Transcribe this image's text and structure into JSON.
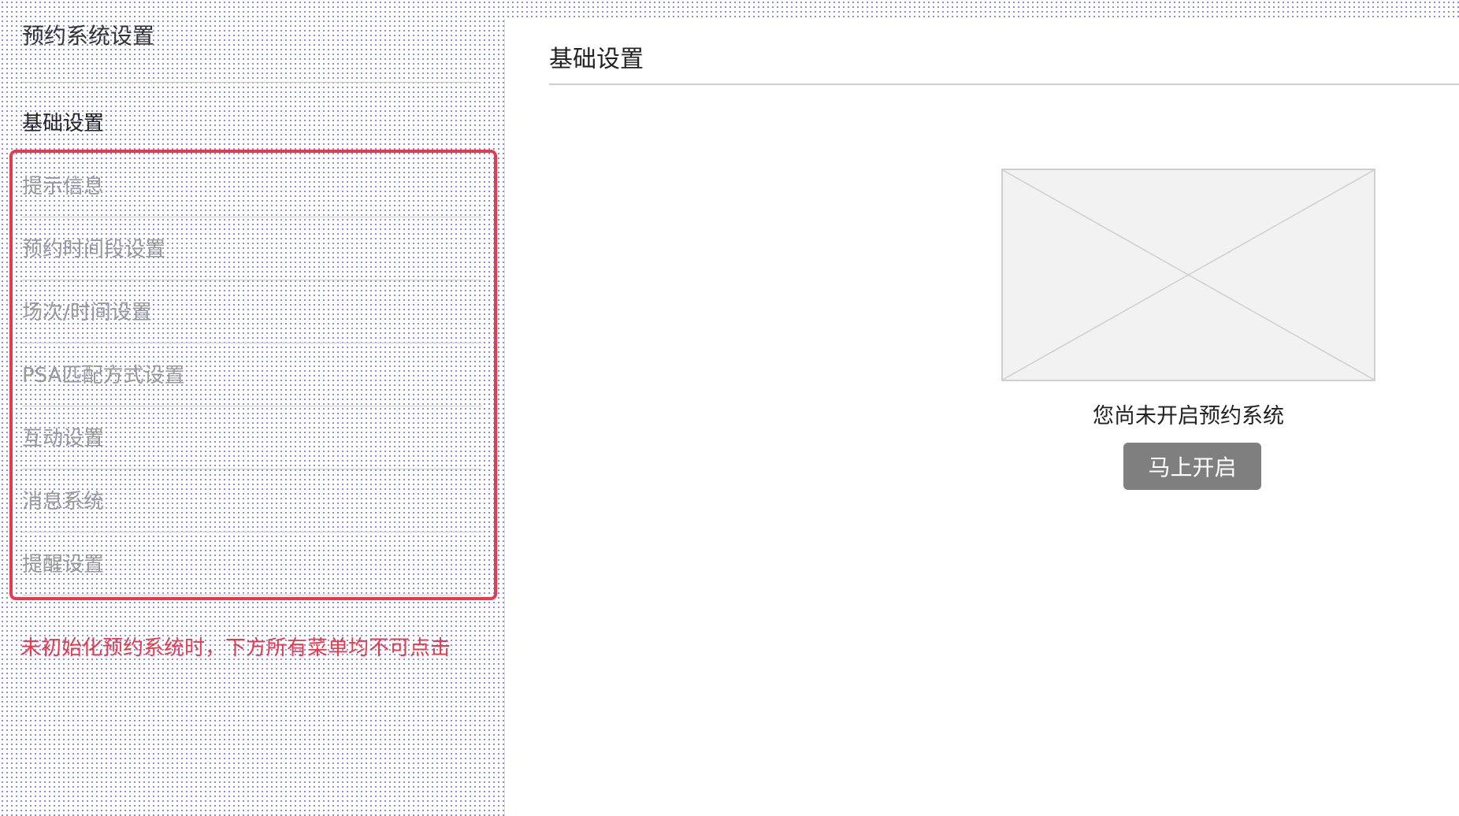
{
  "sidebar": {
    "title": "预约系统设置",
    "section_title": "基础设置",
    "items": [
      {
        "label": "提示信息"
      },
      {
        "label": "预约时间段设置"
      },
      {
        "label": "场次/时间设置"
      },
      {
        "label": "PSA匹配方式设置"
      },
      {
        "label": "互动设置"
      },
      {
        "label": "消息系统"
      },
      {
        "label": "提醒设置"
      }
    ],
    "note": "未初始化预约系统时，下方所有菜单均不可点击"
  },
  "main": {
    "title": "基础设置",
    "empty_state": {
      "image_icon": "image-placeholder-icon",
      "message": "您尚未开启预约系统",
      "button_label": "马上开启"
    }
  },
  "colors": {
    "highlight_red": "#e8394d",
    "disabled_text": "#999999",
    "button_bg": "#7f7f7f",
    "dot_pattern": "#6a74d6"
  }
}
